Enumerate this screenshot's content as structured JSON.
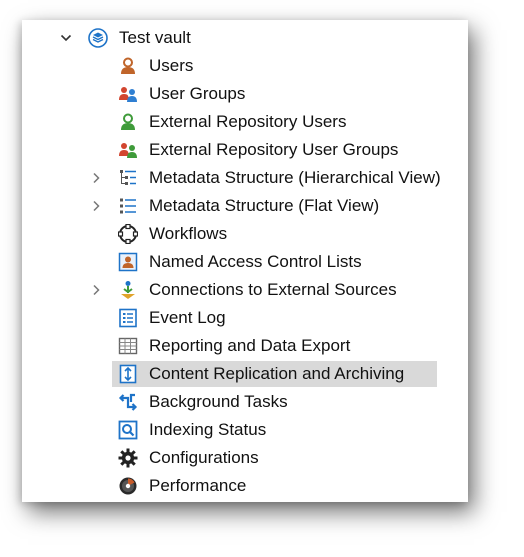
{
  "tree": {
    "root": {
      "label": "Test vault",
      "icon": "vault-cube-icon",
      "expanded": true
    },
    "items": [
      {
        "label": "Users",
        "icon": "user-icon",
        "expandable": false,
        "selected": false
      },
      {
        "label": "User Groups",
        "icon": "user-groups-icon",
        "expandable": false,
        "selected": false
      },
      {
        "label": "External Repository Users",
        "icon": "external-user-icon",
        "expandable": false,
        "selected": false
      },
      {
        "label": "External Repository User Groups",
        "icon": "external-user-groups-icon",
        "expandable": false,
        "selected": false
      },
      {
        "label": "Metadata Structure (Hierarchical View)",
        "icon": "hierarchy-icon",
        "expandable": true,
        "selected": false
      },
      {
        "label": "Metadata Structure (Flat View)",
        "icon": "flat-list-icon",
        "expandable": true,
        "selected": false
      },
      {
        "label": "Workflows",
        "icon": "workflow-icon",
        "expandable": false,
        "selected": false
      },
      {
        "label": "Named Access Control Lists",
        "icon": "access-list-icon",
        "expandable": false,
        "selected": false
      },
      {
        "label": "Connections to External Sources",
        "icon": "connections-icon",
        "expandable": true,
        "selected": false
      },
      {
        "label": "Event Log",
        "icon": "event-log-icon",
        "expandable": false,
        "selected": false
      },
      {
        "label": "Reporting and Data Export",
        "icon": "report-table-icon",
        "expandable": false,
        "selected": false
      },
      {
        "label": "Content Replication and Archiving",
        "icon": "replication-icon",
        "expandable": false,
        "selected": true
      },
      {
        "label": "Background Tasks",
        "icon": "background-tasks-icon",
        "expandable": false,
        "selected": false
      },
      {
        "label": "Indexing Status",
        "icon": "index-search-icon",
        "expandable": false,
        "selected": false
      },
      {
        "label": "Configurations",
        "icon": "gear-icon",
        "expandable": false,
        "selected": false
      },
      {
        "label": "Performance",
        "icon": "performance-disc-icon",
        "expandable": false,
        "selected": false
      }
    ]
  },
  "colors": {
    "selection": "#d9d9d9",
    "accent_blue": "#1e73c8",
    "user_orange": "#c0652a",
    "user_green": "#3f9b3a",
    "text": "#111111"
  }
}
